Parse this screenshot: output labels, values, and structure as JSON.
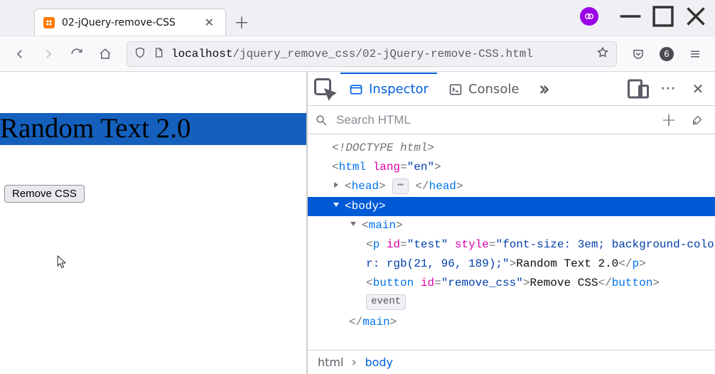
{
  "tab": {
    "title": "02-jQuery-remove-CSS"
  },
  "url": {
    "host": "localhost",
    "path": "/jquery_remove_css/02-jQuery-remove-CSS.html"
  },
  "toolbar": {
    "counter": "6"
  },
  "page": {
    "text": "Random Text 2.0",
    "button_label": "Remove CSS"
  },
  "devtools": {
    "tabs": {
      "inspector": "Inspector",
      "console": "Console"
    },
    "search_placeholder": "Search HTML",
    "breadcrumbs": {
      "html": "html",
      "body": "body"
    },
    "event_pill": "event",
    "markup": {
      "doctype": "<!DOCTYPE html>",
      "html_open": {
        "tag": "html",
        "attr": "lang",
        "val": "\"en\""
      },
      "head": "head",
      "body": "body",
      "main": "main",
      "p": {
        "tag": "p",
        "id_attr": "id",
        "id_val": "\"test\"",
        "style_attr": "style",
        "style_val": "\"font-size: 3em; background-color: rgb(21, 96, 189);\"",
        "text": "Random Text 2.0"
      },
      "button": {
        "tag": "button",
        "id_attr": "id",
        "id_val": "\"remove_css\"",
        "text": "Remove CSS"
      }
    }
  }
}
